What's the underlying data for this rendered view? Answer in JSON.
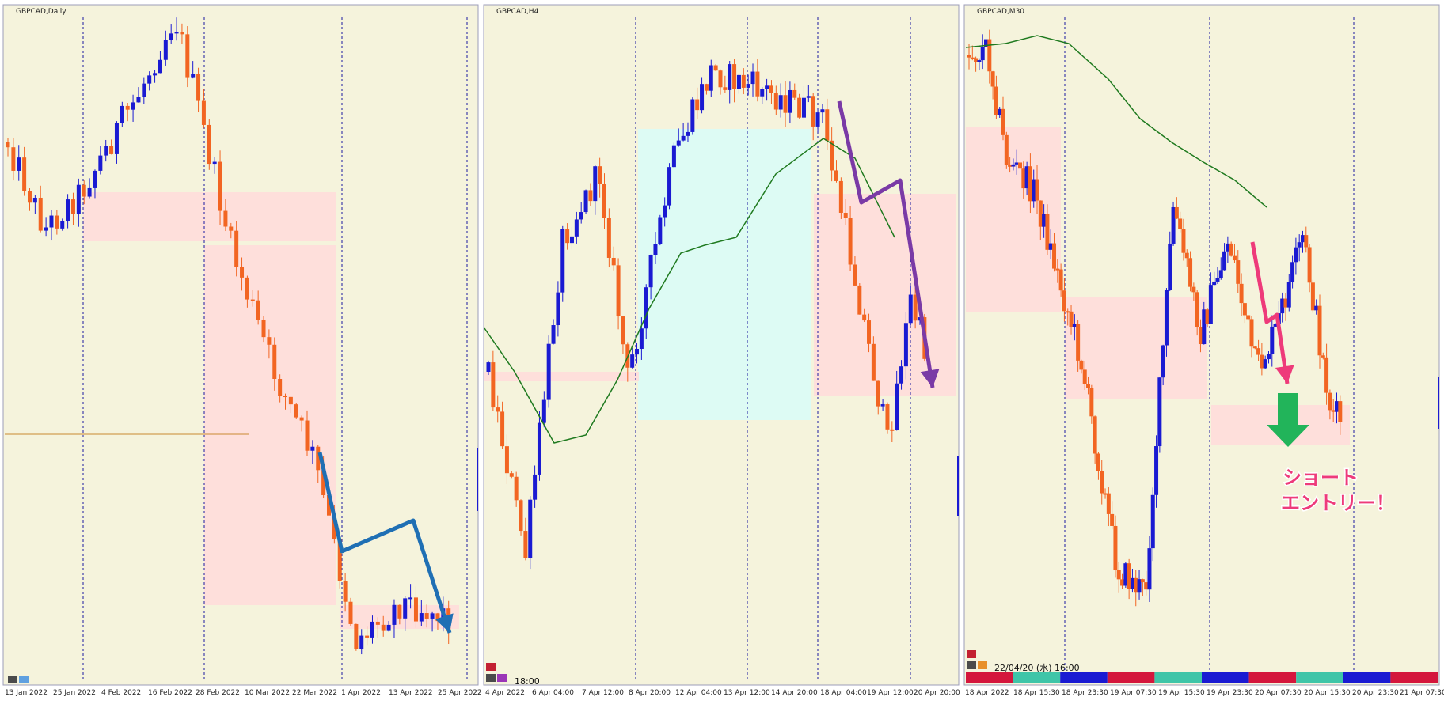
{
  "colors": {
    "background": "#f5f3dc",
    "bull": "#1a1ad2",
    "bear": "#f26522",
    "ma": "#1f7a1f",
    "zone_pink": "#ffdada",
    "zone_cyan": "#d8fbf8",
    "annotation_blue": "#1f6fb4",
    "annotation_purple": "#7a3aa6",
    "annotation_pink": "#ee3a7a",
    "entry_green": "#22b45a",
    "divider": "#8a8aa6",
    "grid": "#1a1aa0"
  },
  "panels": [
    {
      "title": "GBPCAD,Daily",
      "x_labels": [
        "13 Jan 2022",
        "25 Jan 2022",
        "4 Feb 2022",
        "16 Feb 2022",
        "28 Feb 2022",
        "10 Mar 2022",
        "22 Mar 2022",
        "1 Apr 2022",
        "13 Apr 2022",
        "25 Apr 2022"
      ],
      "bottom_text": ""
    },
    {
      "title": "GBPCAD,H4",
      "x_labels": [
        "4 Apr 2022",
        "6 Apr 04:00",
        "7 Apr 12:00",
        "8 Apr 20:00",
        "12 Apr 04:00",
        "13 Apr 12:00",
        "14 Apr 20:00",
        "18 Apr 04:00",
        "19 Apr 12:00",
        "20 Apr 20:00"
      ],
      "bottom_text": "18:00"
    },
    {
      "title": "GBPCAD,M30",
      "x_labels": [
        "18 Apr 2022",
        "18 Apr 15:30",
        "18 Apr 23:30",
        "19 Apr 07:30",
        "19 Apr 15:30",
        "19 Apr 23:30",
        "20 Apr 07:30",
        "20 Apr 15:30",
        "20 Apr 23:30",
        "21 Apr 07:30"
      ],
      "bottom_text": "22/04/20 (水) 16:00"
    }
  ],
  "annotation": {
    "line1": "ショート",
    "line2": "エントリー！"
  },
  "chart_data": [
    {
      "type": "candlestick",
      "title": "GBPCAD,Daily",
      "categories": [
        "13 Jan 2022",
        "25 Jan 2022",
        "4 Feb 2022",
        "16 Feb 2022",
        "28 Feb 2022",
        "10 Mar 2022",
        "22 Mar 2022",
        "1 Apr 2022",
        "13 Apr 2022",
        "25 Apr 2022"
      ],
      "trend": "downtrend",
      "series": [
        {
          "values": [
            1.7135,
            1.7148,
            1.7182,
            1.7165,
            1.7108,
            1.7042,
            1.6949,
            1.6886,
            1.6902,
            1.6878
          ]
        }
      ]
    },
    {
      "type": "candlestick",
      "title": "GBPCAD,H4",
      "categories": [
        "4 Apr 2022",
        "6 Apr 04:00",
        "7 Apr 12:00",
        "8 Apr 20:00",
        "12 Apr 04:00",
        "13 Apr 12:00",
        "14 Apr 20:00",
        "18 Apr 04:00",
        "19 Apr 12:00",
        "20 Apr 20:00"
      ],
      "has_moving_average": true,
      "series": [
        {
          "values": [
            1.6878,
            1.683,
            1.6901,
            1.6905,
            1.6935,
            1.6948,
            1.695,
            1.6935,
            1.6912,
            1.6915
          ]
        }
      ]
    },
    {
      "type": "candlestick",
      "title": "GBPCAD,M30",
      "categories": [
        "18 Apr 2022",
        "18 Apr 15:30",
        "18 Apr 23:30",
        "19 Apr 07:30",
        "19 Apr 15:30",
        "19 Apr 23:30",
        "20 Apr 07:30",
        "20 Apr 15:30",
        "20 Apr 23:30",
        "21 Apr 07:30"
      ],
      "has_moving_average": true,
      "series": [
        {
          "values": [
            1.695,
            1.6935,
            1.6905,
            1.6882,
            1.692,
            1.6918,
            1.6905,
            1.6902,
            1.69,
            1.6898
          ]
        }
      ]
    }
  ]
}
